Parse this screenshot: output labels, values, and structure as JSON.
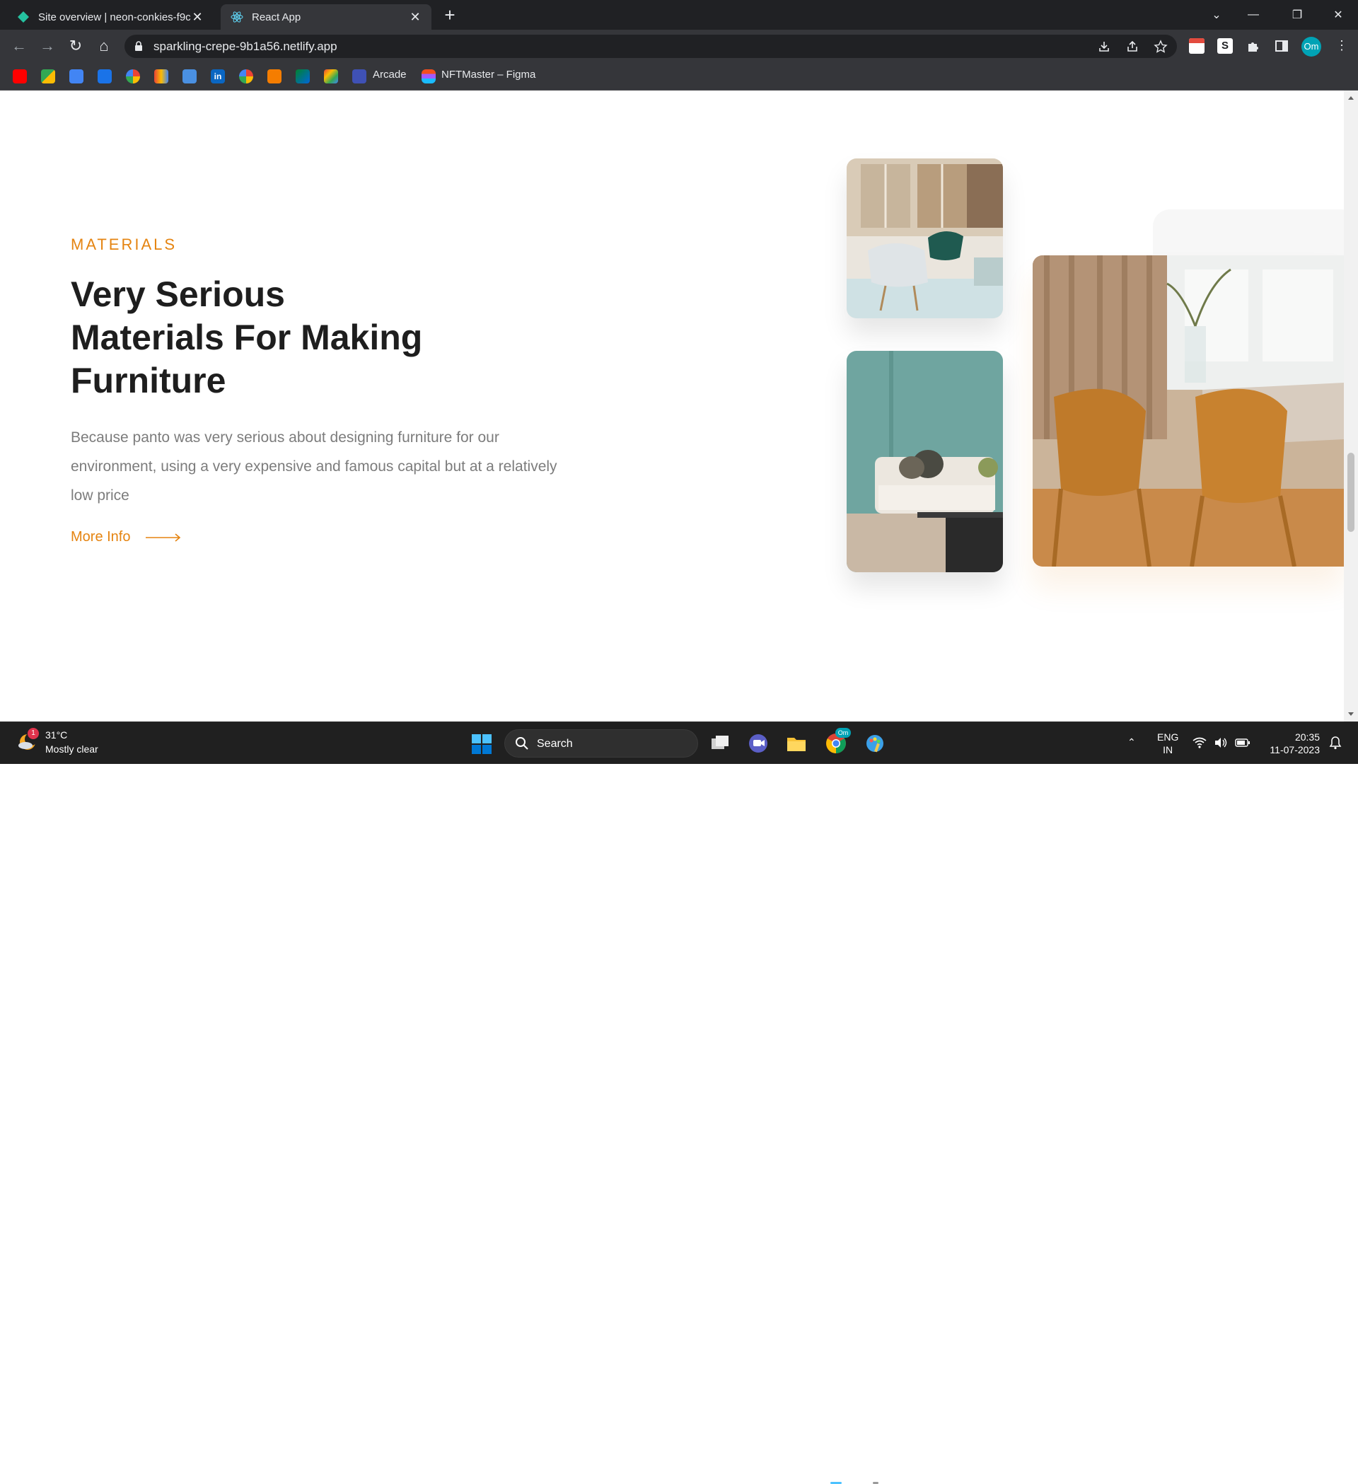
{
  "browser": {
    "tabs": [
      {
        "title": "Site overview | neon-conkies-f9c",
        "active": false,
        "icon": "netlify-icon"
      },
      {
        "title": "React App",
        "active": true,
        "icon": "react-icon"
      }
    ],
    "new_tab_symbol": "+",
    "url": "sparkling-crepe-9b1a56.netlify.app",
    "profile_initials": "Om",
    "bookmarks": [
      {
        "label": "Arcade",
        "icon": "arcade-icon"
      },
      {
        "label": "NFTMaster – Figma",
        "icon": "figma-icon"
      }
    ],
    "bookmark_icons": [
      "youtube-icon",
      "maps-icon",
      "translate-icon",
      "gsuite-icon",
      "google-icon",
      "cloud-icon",
      "drive-icon",
      "linkedin-icon",
      "google-icon",
      "blogger-icon",
      "meet-icon",
      "gmail-icon"
    ]
  },
  "page": {
    "eyebrow": "MATERIALS",
    "headline_lines": [
      "Very Serious",
      "Materials For Making",
      "Furniture"
    ],
    "lede": "Because panto was very serious about designing furniture for our environment, using a very expensive and famous capital but at a relatively low price",
    "cta_label": "More Info",
    "accent_color": "#E58411",
    "images": [
      "lounge-chairs-photo",
      "living-room-sofa-photo",
      "dining-chairs-photo"
    ]
  },
  "taskbar": {
    "weather_badge": "1",
    "temperature": "31°C",
    "condition": "Mostly clear",
    "search_label": "Search",
    "chrome_profile_badge": "Om",
    "language_line1": "ENG",
    "language_line2": "IN",
    "time": "20:35",
    "date": "11-07-2023"
  }
}
